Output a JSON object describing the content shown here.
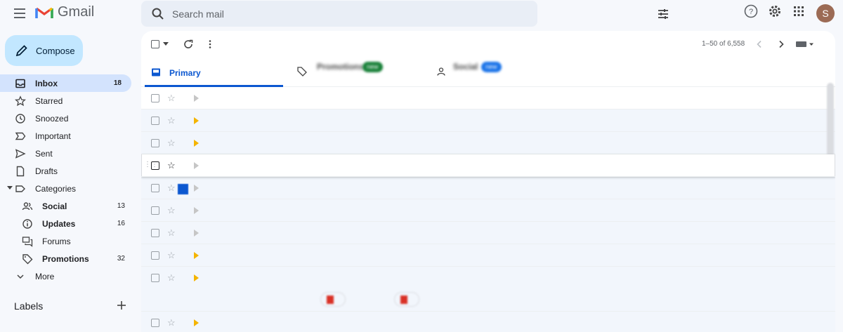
{
  "app": {
    "name": "Gmail"
  },
  "search": {
    "placeholder": "Search mail"
  },
  "avatar": {
    "initial": "S"
  },
  "compose": {
    "label": "Compose"
  },
  "nav": {
    "items": [
      {
        "label": "Inbox",
        "count": "18"
      },
      {
        "label": "Starred",
        "count": ""
      },
      {
        "label": "Snoozed",
        "count": ""
      },
      {
        "label": "Important",
        "count": ""
      },
      {
        "label": "Sent",
        "count": ""
      },
      {
        "label": "Drafts",
        "count": ""
      },
      {
        "label": "Categories",
        "count": ""
      },
      {
        "label": "Social",
        "count": "13"
      },
      {
        "label": "Updates",
        "count": "16"
      },
      {
        "label": "Forums",
        "count": ""
      },
      {
        "label": "Promotions",
        "count": "32"
      },
      {
        "label": "More",
        "count": ""
      }
    ]
  },
  "labels": {
    "heading": "Labels"
  },
  "toolbar": {
    "pager": "1–50 of 6,558"
  },
  "tabs": {
    "primary": "Primary",
    "promotions": {
      "name": "Promotions",
      "badge": "new",
      "snippet": ""
    },
    "social": {
      "name": "Social",
      "badge": "new",
      "snippet": ""
    }
  },
  "colors": {
    "accent": "#0b57d0",
    "compose_bg": "#c2e7ff",
    "active_nav": "#d3e3fd",
    "promo_badge": "#188038",
    "social_badge": "#1a73e8"
  }
}
